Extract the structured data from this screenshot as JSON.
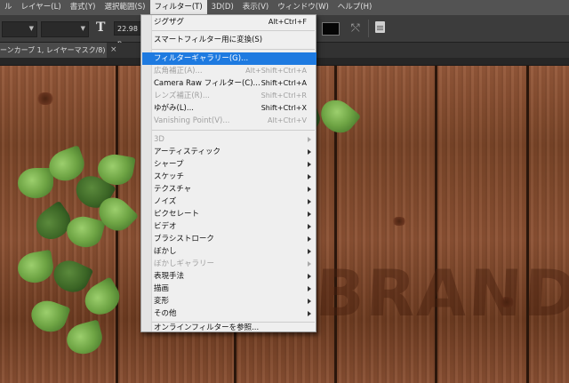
{
  "menubar": {
    "items": [
      "ル",
      "レイヤー(L)",
      "書式(Y)",
      "選択範囲(S)",
      "フィルター(T)",
      "3D(D)",
      "表示(V)",
      "ウィンドウ(W)",
      "ヘルプ(H)"
    ]
  },
  "options": {
    "font_size_value": "22.98 p",
    "font_size_icon": "T"
  },
  "document_tab": {
    "label": "ーンカーブ 1, レイヤーマスク/8) *",
    "close_glyph": "×"
  },
  "canvas": {
    "brand_text": "BRAND"
  },
  "filter_menu": {
    "items": [
      {
        "label": "ジグザグ",
        "shortcut": "Alt+Ctrl+F"
      },
      {
        "label": "スマートフィルター用に変換(S)",
        "shortcut": ""
      },
      {
        "label": "フィルターギャラリー(G)...",
        "shortcut": ""
      },
      {
        "label": "広角補正(A)...",
        "shortcut": "Alt+Shift+Ctrl+A"
      },
      {
        "label": "Camera Raw フィルター(C)...",
        "shortcut": "Shift+Ctrl+A"
      },
      {
        "label": "レンズ補正(R)...",
        "shortcut": "Shift+Ctrl+R"
      },
      {
        "label": "ゆがみ(L)...",
        "shortcut": "Shift+Ctrl+X"
      },
      {
        "label": "Vanishing Point(V)...",
        "shortcut": "Alt+Ctrl+V"
      },
      {
        "label": "3D",
        "shortcut": ""
      },
      {
        "label": "アーティスティック",
        "shortcut": ""
      },
      {
        "label": "シャープ",
        "shortcut": ""
      },
      {
        "label": "スケッチ",
        "shortcut": ""
      },
      {
        "label": "テクスチャ",
        "shortcut": ""
      },
      {
        "label": "ノイズ",
        "shortcut": ""
      },
      {
        "label": "ピクセレート",
        "shortcut": ""
      },
      {
        "label": "ビデオ",
        "shortcut": ""
      },
      {
        "label": "ブラシストローク",
        "shortcut": ""
      },
      {
        "label": "ぼかし",
        "shortcut": ""
      },
      {
        "label": "ぼかしギャラリー",
        "shortcut": ""
      },
      {
        "label": "表現手法",
        "shortcut": ""
      },
      {
        "label": "描画",
        "shortcut": ""
      },
      {
        "label": "変形",
        "shortcut": ""
      },
      {
        "label": "その他",
        "shortcut": ""
      },
      {
        "label": "オンラインフィルターを参照...",
        "shortcut": ""
      }
    ]
  },
  "colors": {
    "menu_highlight": "#1e7ae0",
    "menu_background": "#efefef",
    "app_background": "#535353"
  }
}
